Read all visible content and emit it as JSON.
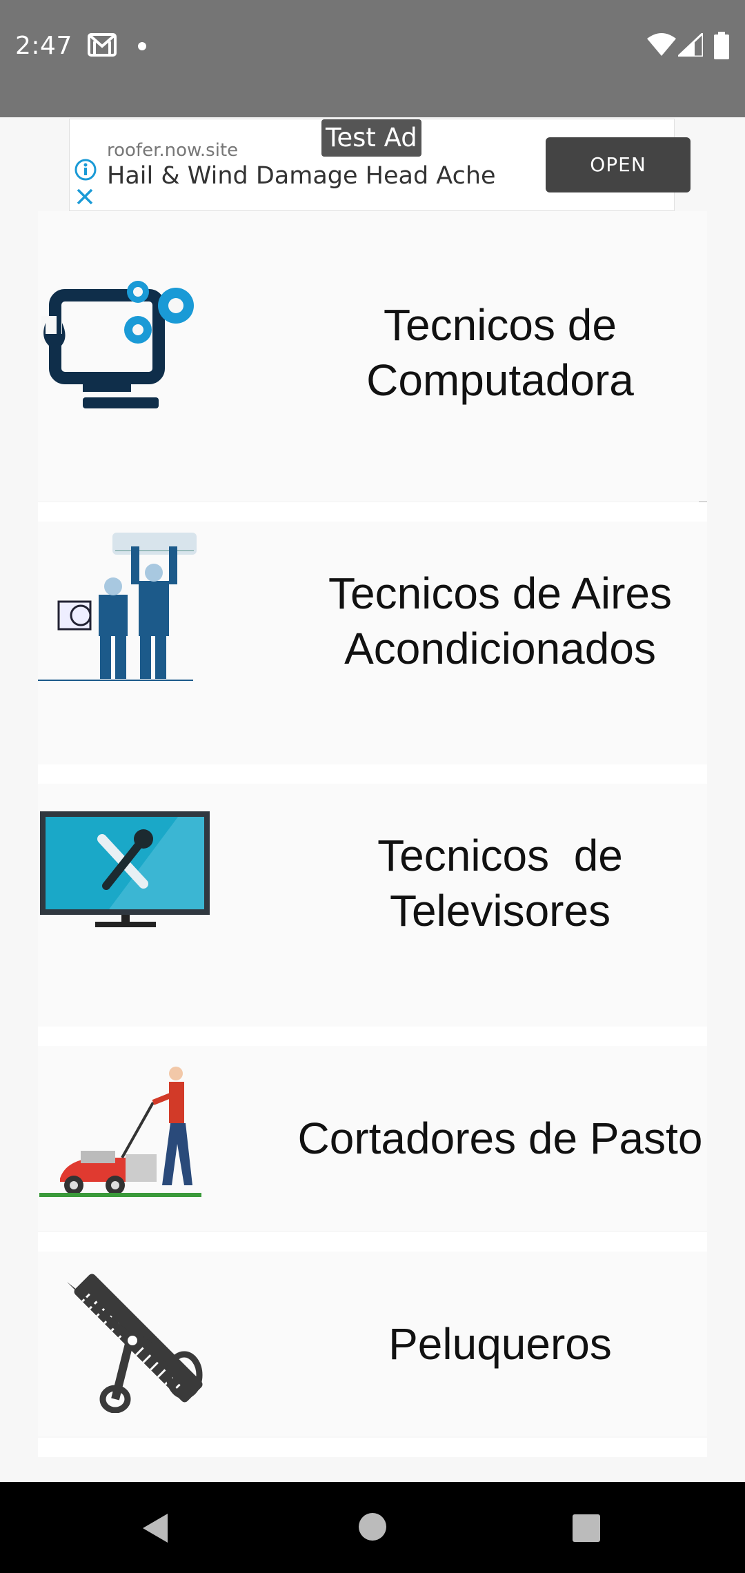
{
  "status_bar": {
    "time": "2:47",
    "icons": [
      "gmail-icon",
      "notification-dot-icon",
      "wifi-icon",
      "cell-signal-icon",
      "battery-icon"
    ]
  },
  "ad": {
    "badge": "Test Ad",
    "domain": "roofer.now.site",
    "headline": "Hail & Wind Damage Head Ache",
    "open_label": "OPEN"
  },
  "categories": [
    {
      "label_line1": "Tecnicos de",
      "label_line2": "Computadora",
      "icon": "computer-repair-icon"
    },
    {
      "label_line1": "Tecnicos de Aires",
      "label_line2": "Acondicionados",
      "icon": "air-conditioner-technicians-icon"
    },
    {
      "label_line1": "Tecnicos  de",
      "label_line2": "Televisores",
      "icon": "tv-repair-icon"
    },
    {
      "label_line1": "Cortadores de Pasto",
      "label_line2": "",
      "icon": "lawn-mower-icon"
    },
    {
      "label_line1": "Peluqueros",
      "label_line2": "",
      "icon": "scissors-comb-icon"
    }
  ],
  "colors": {
    "status_bar": "#757575",
    "nav_bar": "#000000",
    "accent_blue": "#1a9ad6",
    "dark_navy": "#0f2e4a"
  }
}
